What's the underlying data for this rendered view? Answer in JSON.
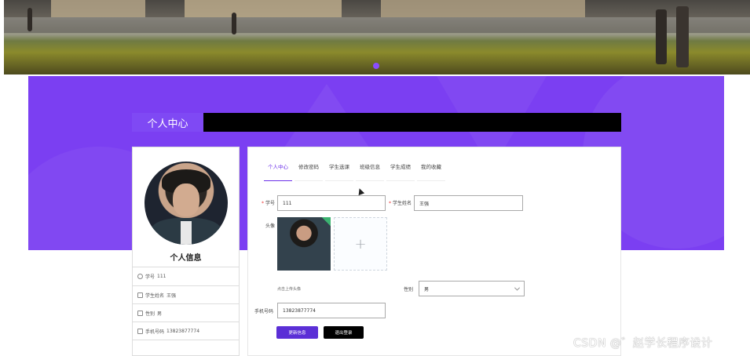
{
  "banner": {
    "carousel_indicator": "dot"
  },
  "page": {
    "title_tab": "个人中心"
  },
  "profile": {
    "name": "个人信息",
    "rows": [
      {
        "icon": "user-icon",
        "label": "学号",
        "value": "111"
      },
      {
        "icon": "idcard-icon",
        "label": "学生姓名",
        "value": "王强"
      },
      {
        "icon": "gender-icon",
        "label": "性别",
        "value": "男"
      },
      {
        "icon": "phone-icon",
        "label": "手机号码",
        "value": "13823877774"
      }
    ]
  },
  "tabs": [
    {
      "label": "个人中心",
      "active": true
    },
    {
      "label": "修改密码",
      "active": false
    },
    {
      "label": "学生选课",
      "active": false
    },
    {
      "label": "班级信息",
      "active": false
    },
    {
      "label": "学生成绩",
      "active": false
    },
    {
      "label": "我的收藏",
      "active": false
    }
  ],
  "form": {
    "student_id": {
      "label": "学号",
      "value": "111"
    },
    "student_name": {
      "label": "学生姓名",
      "value": "王强"
    },
    "avatar": {
      "label": "头像",
      "upload_hint": "点击上传头像",
      "plus": "+"
    },
    "gender": {
      "label": "性别",
      "value": "男"
    },
    "phone": {
      "label": "手机号码",
      "value": "13823877774"
    },
    "update_button": "更新信息",
    "logout_button": "退出登录"
  },
  "watermark": "CSDN @゛赵学长程序设计",
  "colors": {
    "accent": "#7b3ff2",
    "button_primary": "#5b2fd6",
    "button_dark": "#000000"
  }
}
